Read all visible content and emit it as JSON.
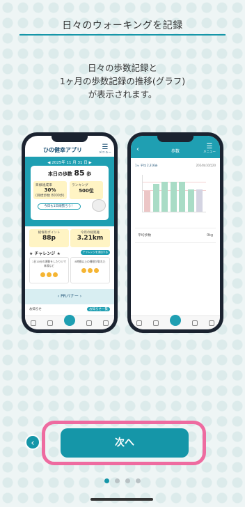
{
  "header": {
    "title": "日々のウォーキングを記録"
  },
  "description": [
    "日々の歩数記録と",
    "1ヶ月の歩数記録の推移(グラフ)",
    "が表示されます。"
  ],
  "phone1": {
    "app_title": "ひの健幸アプリ",
    "menu_label": "メニュー",
    "date": "2025年 11 月 31 日",
    "today_steps_label": "本日の歩数",
    "today_steps_value": "85",
    "today_steps_unit": "歩",
    "goal_label": "目標達成率",
    "goal_value": "30%",
    "goal_sub": "(目標歩数 8000歩)",
    "ranking_label": "ランキング",
    "ranking_value": "500位",
    "cheer": "今日も1日頑張ろう！",
    "points_label": "総保有ポイント",
    "points_value": "88p",
    "distance_label": "今月の総距離",
    "distance_value": "3.21km",
    "challenge_title": "チャレンジ",
    "challenge_button": "チャレンジを追加する",
    "challenge_card1": "1日10分の運動をしたりジで体操など",
    "challenge_card2": "8時間以上の睡眠が取れた",
    "banner": "PRバナー",
    "news_label": "お知らせ",
    "news_more": "お知らせ一覧"
  },
  "phone2": {
    "title": "歩数",
    "menu_label": "メニュー",
    "chart_header": "1ヶ 平均 2,316歩",
    "chart_date": "2024年10月20",
    "avg_label": "平均歩数",
    "avg_value": "0kg"
  },
  "chart_bars": [
    {
      "value": 0.55,
      "color": "#ecc6c6"
    },
    {
      "value": 0.75,
      "color": "#a9dcc6"
    },
    {
      "value": 0.8,
      "color": "#a9dcc6"
    },
    {
      "value": 0.8,
      "color": "#a9dcc6"
    },
    {
      "value": 0.8,
      "color": "#a9dcc6"
    },
    {
      "value": 0.6,
      "color": "#a9dcc6"
    },
    {
      "value": 0.6,
      "color": "#d4d4e2"
    }
  ],
  "footer": {
    "next_label": "次へ",
    "back_icon": "‹",
    "page_count": 4,
    "current_page": 1
  },
  "colors": {
    "accent": "#1596a8",
    "highlight": "#ee6ba0"
  }
}
